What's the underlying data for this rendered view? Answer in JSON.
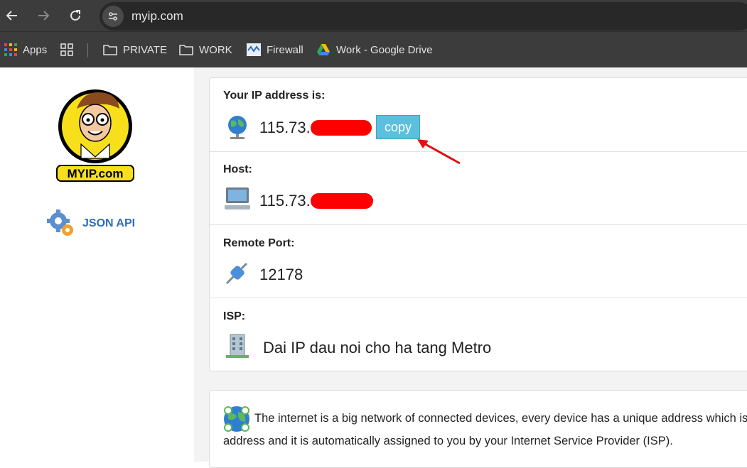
{
  "browser": {
    "url": "myip.com",
    "bookmarks": [
      {
        "label": "Apps",
        "icon": "apps-grid-icon"
      },
      {
        "label": "PRIVATE",
        "icon": "folder-icon"
      },
      {
        "label": "WORK",
        "icon": "folder-icon"
      },
      {
        "label": "Firewall",
        "icon": "firewall-favicon"
      },
      {
        "label": "Work - Google Drive",
        "icon": "google-drive-icon"
      }
    ]
  },
  "sidebar": {
    "logo_text": "MYIP.com",
    "json_api_label": "JSON API"
  },
  "main": {
    "ip": {
      "label": "Your IP address is:",
      "value": "115.73.",
      "copy_label": "copy"
    },
    "host": {
      "label": "Host:",
      "value": "115.73."
    },
    "port": {
      "label": "Remote Port:",
      "value": "12178"
    },
    "isp": {
      "label": "ISP:",
      "value": "Dai IP dau noi cho ha tang Metro"
    },
    "info": {
      "line1": "The internet is a big network of connected devices, every device has a unique address which is",
      "line2": "address and it is automatically assigned to you by your Internet Service Provider (ISP)."
    }
  },
  "colors": {
    "accent": "#2f6db5",
    "copy_button": "#5bc0de",
    "redaction": "#ff0000",
    "annotation_arrow": "#e01010"
  }
}
